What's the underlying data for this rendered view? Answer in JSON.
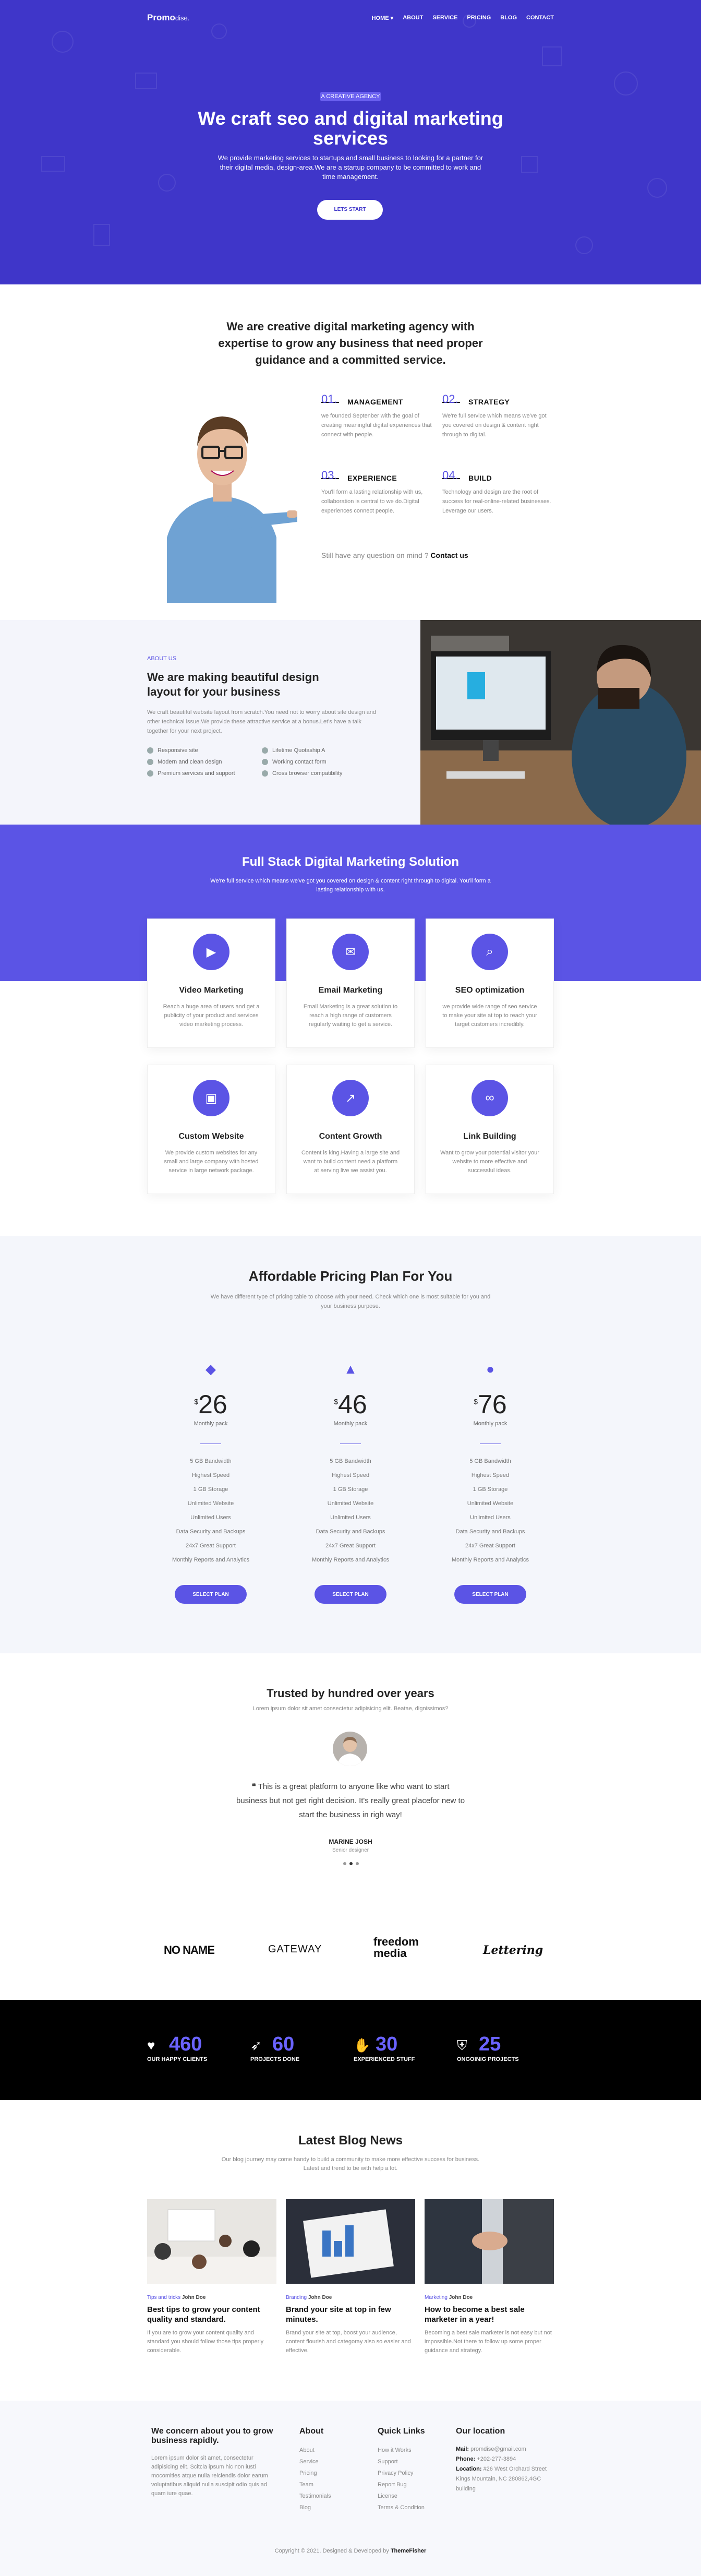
{
  "nav": {
    "logo_main": "Promo",
    "logo_sub": "dise.",
    "links": [
      "HOME ▾",
      "ABOUT",
      "SERVICE",
      "PRICING",
      "BLOG",
      "CONTACT"
    ]
  },
  "hero": {
    "badge": "A CREATIVE AGENCY",
    "title": "We craft seo and digital marketing services",
    "text": "We provide marketing services to startups and small business to looking for a partner for their digital media, design-area.We are a startup company to be committed to work and time management.",
    "button": "LETS START"
  },
  "intro": {
    "title": "We are creative digital marketing agency with expertise to grow any business that need proper guidance and a committed service.",
    "features": [
      {
        "num": "01.",
        "title": "MANAGEMENT",
        "text": "we founded Septenber with the goal of creating meaningful digital experiences that connect with people."
      },
      {
        "num": "02.",
        "title": "STRATEGY",
        "text": "We're full service which means we've got you covered on design & content right through to digital."
      },
      {
        "num": "03.",
        "title": "EXPERIENCE",
        "text": "You'll form a lasting relationship with us, collaboration is central to we do.Digital experiences connect people."
      },
      {
        "num": "04.",
        "title": "BUILD",
        "text": "Technology and design are the root of success for real-online-related businesses. Leverage our users."
      }
    ],
    "question": "Still have any question on mind ?",
    "question_link": "Contact us"
  },
  "about": {
    "label": "ABOUT US",
    "title": "We are making beautiful design layout for your business",
    "text": "We craft beautiful website layout from scratch.You need not to worry about site design and other technical issue.We provide these attractive service at a bonus.Let's have a talk together for your next project.",
    "checks": [
      "Responsive site",
      "Lifetime Quotaship A",
      "Modern and clean design",
      "Working contact form",
      "Premium services and support",
      "Cross browser compatibility"
    ]
  },
  "services": {
    "title": "Full Stack Digital Marketing Solution",
    "subtitle": "We're full service which means we've got you covered on design & content right through to digital. You'll form a lasting relationship with us.",
    "cards": [
      {
        "icon": "video-icon",
        "title": "Video Marketing",
        "text": "Reach a huge area of users and get a publicity of your product and services video marketing process."
      },
      {
        "icon": "megaphone-icon",
        "title": "Email Marketing",
        "text": "Email Marketing is a great solution to reach a high range of customers regularly waiting to get a service."
      },
      {
        "icon": "search-icon",
        "title": "SEO optimization",
        "text": "we provide wide range of seo service to make your site at top to reach your target customers incredibly."
      },
      {
        "icon": "website-icon",
        "title": "Custom Website",
        "text": "We provide custom websites for any small and large company with hosted service in large network package."
      },
      {
        "icon": "growth-icon",
        "title": "Content Growth",
        "text": "Content is king.Having a large site and want to build content need a platform at serving live we assist you."
      },
      {
        "icon": "link-icon",
        "title": "Link Building",
        "text": "Want to grow your potential visitor your website to more effective and successful ideas."
      }
    ]
  },
  "pricing": {
    "title": "Affordable Pricing Plan For You",
    "subtitle": "We have different type of pricing table to choose with your need. Check which one is most suitable for you and your business purpose.",
    "plans": [
      {
        "icon": "diamond-icon",
        "currency": "$",
        "price": "26",
        "period": "Monthly pack"
      },
      {
        "icon": "rocket-icon",
        "currency": "$",
        "price": "46",
        "period": "Monthly pack"
      },
      {
        "icon": "bulb-icon",
        "currency": "$",
        "price": "76",
        "period": "Monthly pack"
      }
    ],
    "features": [
      "5 GB Bandwidth",
      "Highest Speed",
      "1 GB Storage",
      "Unlimited Website",
      "Unlimited Users",
      "Data Security and Backups",
      "24x7 Great Support",
      "Monthly Reports and Analytics"
    ],
    "button": "SELECT PLAN"
  },
  "testimonial": {
    "title": "Trusted by hundred over years",
    "subtitle": "Lorem ipsum dolor sit amet consectetur adipisicing elit. Beatae, dignissimos?",
    "quote": "This is a great platform to anyone like who want to start business but not get right decision. It's really great placefor new to start the business in righ way!",
    "name": "MARINE JOSH",
    "role": "Senior designer"
  },
  "brands": [
    "NO NAME",
    "GATEWAY",
    "freedom media",
    "Lettering"
  ],
  "stats": [
    {
      "icon": "heart-icon",
      "value": "460",
      "label": "OUR HAPPY CLIENTS"
    },
    {
      "icon": "rocket-icon",
      "value": "60",
      "label": "PROJECTS DONE"
    },
    {
      "icon": "hand-icon",
      "value": "30",
      "label": "EXPERIENCED STUFF"
    },
    {
      "icon": "shield-icon",
      "value": "25",
      "label": "ONGOINIG PROJECTS"
    }
  ],
  "blog": {
    "title": "Latest Blog News",
    "subtitle": "Our blog journey may come handy to build a community to make more effective success for business. Latest and trend to be with help a lot.",
    "posts": [
      {
        "cat": "Tips and tricks",
        "author": "John Doe",
        "title": "Best tips to grow your content quality and standard.",
        "text": "If you are to grow your content quality and standard you should follow those tips properly considerable."
      },
      {
        "cat": "Branding",
        "author": "John Doe",
        "title": "Brand your site at top in few minutes.",
        "text": "Brand your site at top, boost your audience, content flourish and categoray also so easier and effective."
      },
      {
        "cat": "Marketing",
        "author": "John Doe",
        "title": "How to become a best sale marketer in a year!",
        "text": "Becoming a best sale marketer is not easy but not impossible.Not there to follow up some proper guidance and strategy."
      }
    ]
  },
  "footer": {
    "about_title": "We concern about you to grow business rapidly.",
    "about_text": "Lorem ipsum dolor sit amet, consectetur adipisicing elit. Scitcla ipsum hic non iusti mocomities atque nulla reiciendis dolor earum voluptatibus aliquid nulla suscipit odio quis ad quam iure quae.",
    "col_about": "About",
    "about_links": [
      "About",
      "Service",
      "Pricing",
      "Team",
      "Testimonials",
      "Blog"
    ],
    "col_quick": "Quick Links",
    "quick_links": [
      "How it Works",
      "Support",
      "Privacy Policy",
      "Report Bug",
      "License",
      "Terms & Condition"
    ],
    "col_loc": "Our location",
    "mail_label": "Mail:",
    "mail": "promdise@gmail.com",
    "phone_label": "Phone:",
    "phone": "+202-277-3894",
    "loc_label": "Location:",
    "loc": "#26 West Orchard Street Kings Mountain, NC 280862,4GC building",
    "copy": "Copyright © 2021. Designed & Developed by",
    "copy_brand": "ThemeFisher"
  }
}
